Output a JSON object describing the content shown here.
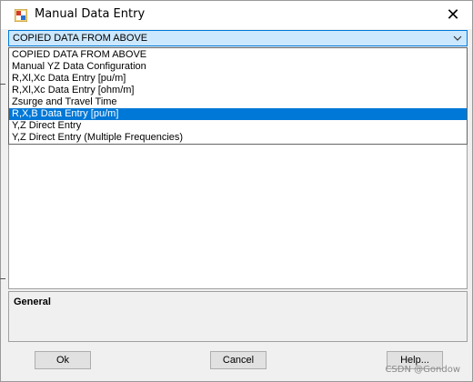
{
  "window": {
    "title": "Manual Data Entry",
    "close_glyph": "✕"
  },
  "combo": {
    "value": "COPIED DATA FROM ABOVE",
    "options": [
      "COPIED DATA FROM ABOVE",
      "Manual YZ Data Configuration",
      "R,Xl,Xc Data Entry [pu/m]",
      "R,Xl,Xc Data Entry [ohm/m]",
      "Zsurge and Travel Time",
      "R,X,B Data Entry [pu/m]",
      "Y,Z Direct Entry",
      "Y,Z Direct Entry (Multiple Frequencies)"
    ],
    "selected_index": 5
  },
  "info_panel": {
    "title": "General"
  },
  "buttons": {
    "ok": "Ok",
    "cancel": "Cancel",
    "help": "Help..."
  },
  "watermark": "CSDN @Gondow",
  "colors": {
    "selection": "#0078d7",
    "combo_focus_bg": "#cce8ff",
    "dialog_bg": "#f0f0f0"
  },
  "icons": {
    "app": "app-icon",
    "close": "close-icon",
    "dropdown": "chevron-down-icon"
  }
}
